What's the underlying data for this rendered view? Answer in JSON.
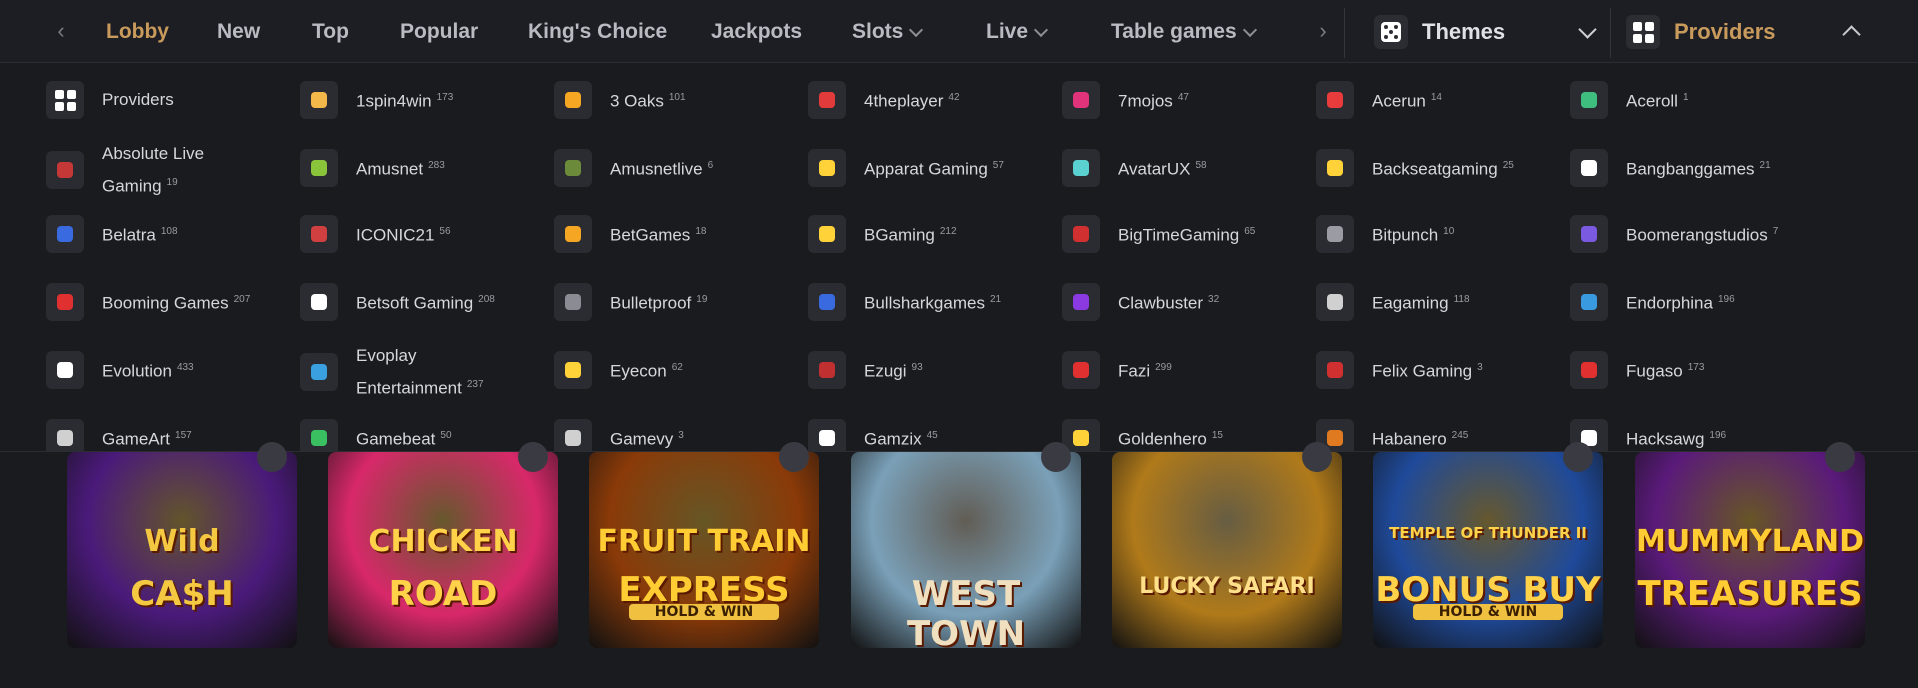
{
  "nav": {
    "items": [
      "Lobby",
      "New",
      "Top",
      "Popular",
      "King's Choice",
      "Jackpots",
      "Slots",
      "Live",
      "Table games"
    ],
    "active": "Lobby",
    "themes_label": "Themes",
    "providers_label": "Providers"
  },
  "colors": {
    "accent": "#c89a5c",
    "background": "#1a1b1f",
    "nav_text": "#b9bac2"
  },
  "providers": [
    {
      "name": "Providers",
      "count": "",
      "icon": "grid-icon"
    },
    {
      "name": "1spin4win",
      "count": "173"
    },
    {
      "name": "3 Oaks",
      "count": "101"
    },
    {
      "name": "4theplayer",
      "count": "42"
    },
    {
      "name": "7mojos",
      "count": "47"
    },
    {
      "name": "Acerun",
      "count": "14"
    },
    {
      "name": "Aceroll",
      "count": "1"
    },
    {
      "name": "Absolute Live Gaming",
      "count": "19"
    },
    {
      "name": "Amusnet",
      "count": "283"
    },
    {
      "name": "Amusnetlive",
      "count": "6"
    },
    {
      "name": "Apparat Gaming",
      "count": "57"
    },
    {
      "name": "AvatarUX",
      "count": "58"
    },
    {
      "name": "Backseatgaming",
      "count": "25"
    },
    {
      "name": "Bangbanggames",
      "count": "21"
    },
    {
      "name": "Belatra",
      "count": "108"
    },
    {
      "name": "ICONIC21",
      "count": "56"
    },
    {
      "name": "BetGames",
      "count": "18"
    },
    {
      "name": "BGaming",
      "count": "212"
    },
    {
      "name": "BigTimeGaming",
      "count": "65"
    },
    {
      "name": "Bitpunch",
      "count": "10"
    },
    {
      "name": "Boomerangstudios",
      "count": "7"
    },
    {
      "name": "Booming Games",
      "count": "207"
    },
    {
      "name": "Betsoft Gaming",
      "count": "208"
    },
    {
      "name": "Bulletproof",
      "count": "19"
    },
    {
      "name": "Bullsharkgames",
      "count": "21"
    },
    {
      "name": "Clawbuster",
      "count": "32"
    },
    {
      "name": "Eagaming",
      "count": "118"
    },
    {
      "name": "Endorphina",
      "count": "196"
    },
    {
      "name": "Evolution",
      "count": "433"
    },
    {
      "name": "Evoplay Entertainment",
      "count": "237"
    },
    {
      "name": "Eyecon",
      "count": "62"
    },
    {
      "name": "Ezugi",
      "count": "93"
    },
    {
      "name": "Fazi",
      "count": "299"
    },
    {
      "name": "Felix Gaming",
      "count": "3"
    },
    {
      "name": "Fugaso",
      "count": "173"
    },
    {
      "name": "GameArt",
      "count": "157"
    },
    {
      "name": "Gamebeat",
      "count": "50"
    },
    {
      "name": "Gamevy",
      "count": "3"
    },
    {
      "name": "Gamzix",
      "count": "45"
    },
    {
      "name": "Goldenhero",
      "count": "15"
    },
    {
      "name": "Habanero",
      "count": "245"
    },
    {
      "name": "Hacksawg",
      "count": "196"
    }
  ],
  "games": [
    {
      "title": "Wild CA$H",
      "line1": "Wild",
      "line2": "CA$H",
      "bg": "#4a1a7a",
      "fg": "#f5c842"
    },
    {
      "title": "Chicken Road",
      "line1": "CHICKEN",
      "line2": "ROAD",
      "bg": "#d8286a",
      "fg": "#ffd24a"
    },
    {
      "title": "Fruit Train Express",
      "line1": "FRUIT TRAIN",
      "line2": "EXPRESS",
      "sub": "HOLD & WIN",
      "bg": "#8a3a08",
      "fg": "#ffcc33"
    },
    {
      "title": "West Town",
      "line1": "",
      "line2": "WEST TOWN",
      "bg": "#7aa0b8",
      "fg": "#f0e0c0"
    },
    {
      "title": "Lucky Safari",
      "line1": "",
      "line2": "LUCKY   SAFARI",
      "bg": "#b07a1a",
      "fg": "#ffe08a"
    },
    {
      "title": "Temple of Thunder II Bonus Buy",
      "line1": "TEMPLE OF THUNDER II",
      "line2": "BONUS BUY",
      "sub": "HOLD & WIN",
      "bg": "#1f4a9a",
      "fg": "#ffd24a"
    },
    {
      "title": "Mummyland Treasures",
      "line1": "MUMMYLAND",
      "line2": "TREASURES",
      "bg": "#5a1a7a",
      "fg": "#ffcc33"
    }
  ]
}
